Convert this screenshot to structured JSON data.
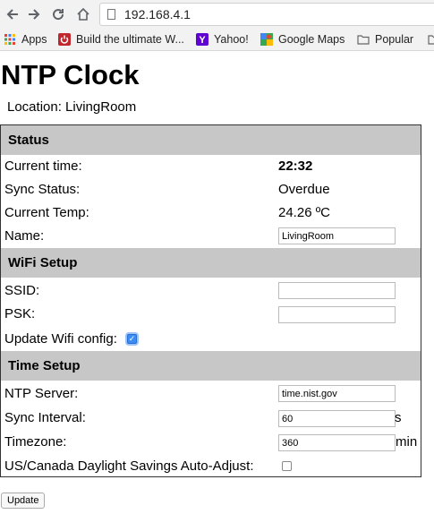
{
  "browser": {
    "url": "192.168.4.1",
    "bookmarks": [
      {
        "label": "Apps",
        "icon": "apps-grid-icon"
      },
      {
        "label": "Build the ultimate W...",
        "icon": "bookmark-red-icon"
      },
      {
        "label": "Yahoo!",
        "icon": "yahoo-icon"
      },
      {
        "label": "Google Maps",
        "icon": "maps-icon"
      },
      {
        "label": "Popular",
        "icon": "folder-icon"
      }
    ]
  },
  "page": {
    "title": "NTP Clock",
    "location": "Location: LivingRoom"
  },
  "status": {
    "header": "Status",
    "current_time_label": "Current time:",
    "current_time_value": "22:32",
    "sync_status_label": "Sync Status:",
    "sync_status_value": "Overdue",
    "current_temp_label": "Current Temp:",
    "current_temp_value": "24.26 ºC",
    "name_label": "Name:",
    "name_value": "LivingRoom"
  },
  "wifi": {
    "header": "WiFi Setup",
    "ssid_label": "SSID:",
    "ssid_value": "",
    "psk_label": "PSK:",
    "psk_value": "",
    "update_label": "Update Wifi config:",
    "update_checked": true
  },
  "time": {
    "header": "Time Setup",
    "ntp_label": "NTP Server:",
    "ntp_value": "time.nist.gov",
    "interval_label": "Sync Interval:",
    "interval_value": "60",
    "interval_unit": "s",
    "tz_label": "Timezone:",
    "tz_value": "360",
    "tz_unit": "min",
    "dst_label": "US/Canada Daylight Savings Auto-Adjust:",
    "dst_checked": false
  },
  "update_button": "Update"
}
